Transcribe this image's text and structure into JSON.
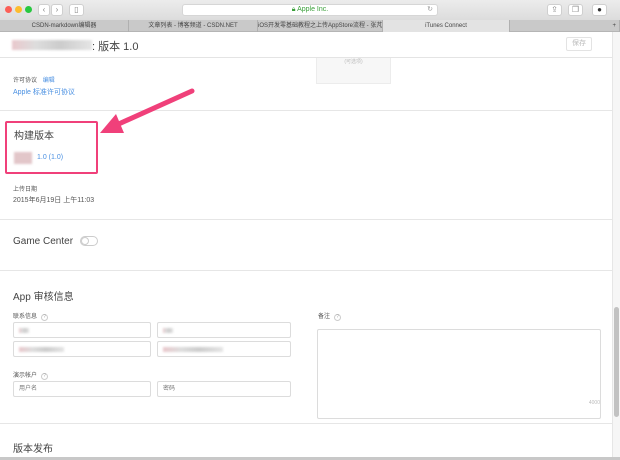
{
  "browser": {
    "url": "Apple Inc.",
    "tabs": [
      {
        "label": "CSDN-markdown编辑器"
      },
      {
        "label": "文章列表 - 博客频道 - CSDN.NET"
      },
      {
        "label": "iOS开发零基础教程之上传AppStore流程 - 张芃..."
      },
      {
        "label": "iTunes Connect"
      }
    ],
    "new_tab": "+"
  },
  "header": {
    "title_suffix": ": 版本 1.0",
    "save_label": "保存"
  },
  "license": {
    "label": "许可协议",
    "edit": "编辑",
    "value": "Apple 标准许可协议",
    "optional_box": "(可选项)"
  },
  "build": {
    "title": "构建版本",
    "version": "1.0 (1.0)",
    "upload_label": "上传日期",
    "upload_value": "2015年6月19日 上午11:03"
  },
  "game_center": {
    "title": "Game Center"
  },
  "review": {
    "title": "App 审核信息",
    "contact_label": "联系信息",
    "demo_label": "演示帐户",
    "username_placeholder": "用户名",
    "password_placeholder": "密码",
    "notes_label": "备注",
    "notes_counter": "4000",
    "help": "?"
  },
  "release": {
    "title": "版本发布"
  },
  "colors": {
    "accent": "#4a90e2",
    "annotation": "#f0407a"
  }
}
